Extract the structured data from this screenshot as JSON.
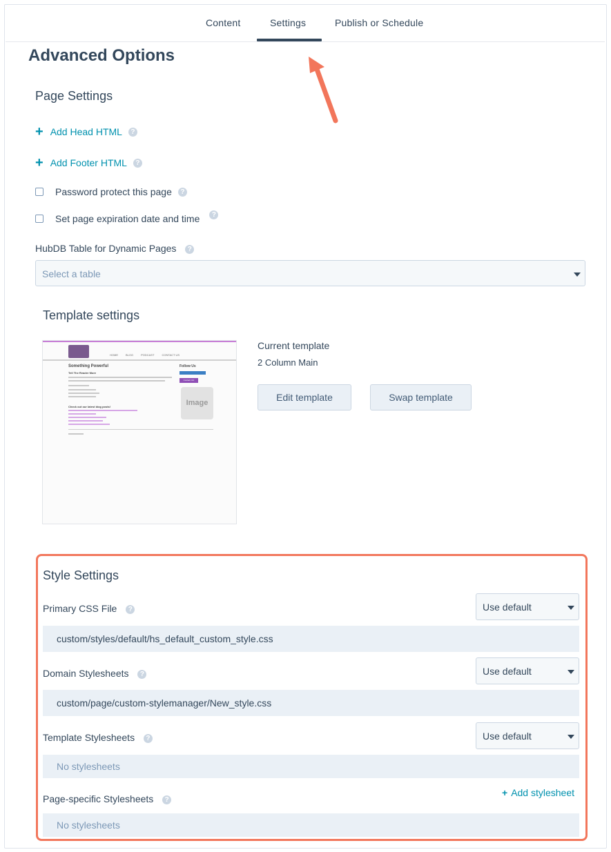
{
  "tabs": [
    {
      "label": "Content"
    },
    {
      "label": "Settings"
    },
    {
      "label": "Publish or Schedule"
    }
  ],
  "active_tab": "Settings",
  "page": {
    "title": "Advanced Options"
  },
  "page_settings": {
    "title": "Page Settings",
    "add_head_html": "Add Head HTML",
    "add_footer_html": "Add Footer HTML",
    "password_protect": "Password protect this page",
    "expiration": "Set page expiration date and time",
    "hubdb_label": "HubDB Table for Dynamic Pages",
    "hubdb_placeholder": "Select a table"
  },
  "template_settings": {
    "title": "Template settings",
    "current_label": "Current template",
    "current_value": "2 Column Main",
    "edit_button": "Edit template",
    "swap_button": "Swap template",
    "preview": {
      "nav": [
        "HOME",
        "BLOG",
        "PODCAST",
        "CONTACT US"
      ],
      "heading": "Something Powerful",
      "subheading": "Tell The Reader More",
      "follow": "Follow Us",
      "contact_btn": "Contact Us!",
      "image_label": "Image",
      "blog_heading": "Check out our latest blog posts!"
    }
  },
  "style_settings": {
    "title": "Style Settings",
    "primary_css": {
      "label": "Primary CSS File",
      "select": "Use default",
      "value": "custom/styles/default/hs_default_custom_style.css"
    },
    "domain": {
      "label": "Domain Stylesheets",
      "select": "Use default",
      "value": "custom/page/custom-stylemanager/New_style.css"
    },
    "template": {
      "label": "Template Stylesheets",
      "select": "Use default",
      "value": "No stylesheets"
    },
    "page_specific": {
      "label": "Page-specific Stylesheets",
      "add_link": "Add stylesheet",
      "value": "No stylesheets"
    }
  },
  "colors": {
    "accent": "#0091ae",
    "highlight": "#f2765b",
    "text": "#33475b"
  },
  "icons": [
    "plus-icon",
    "help-icon",
    "caret-down-icon",
    "arrow-annotation"
  ]
}
